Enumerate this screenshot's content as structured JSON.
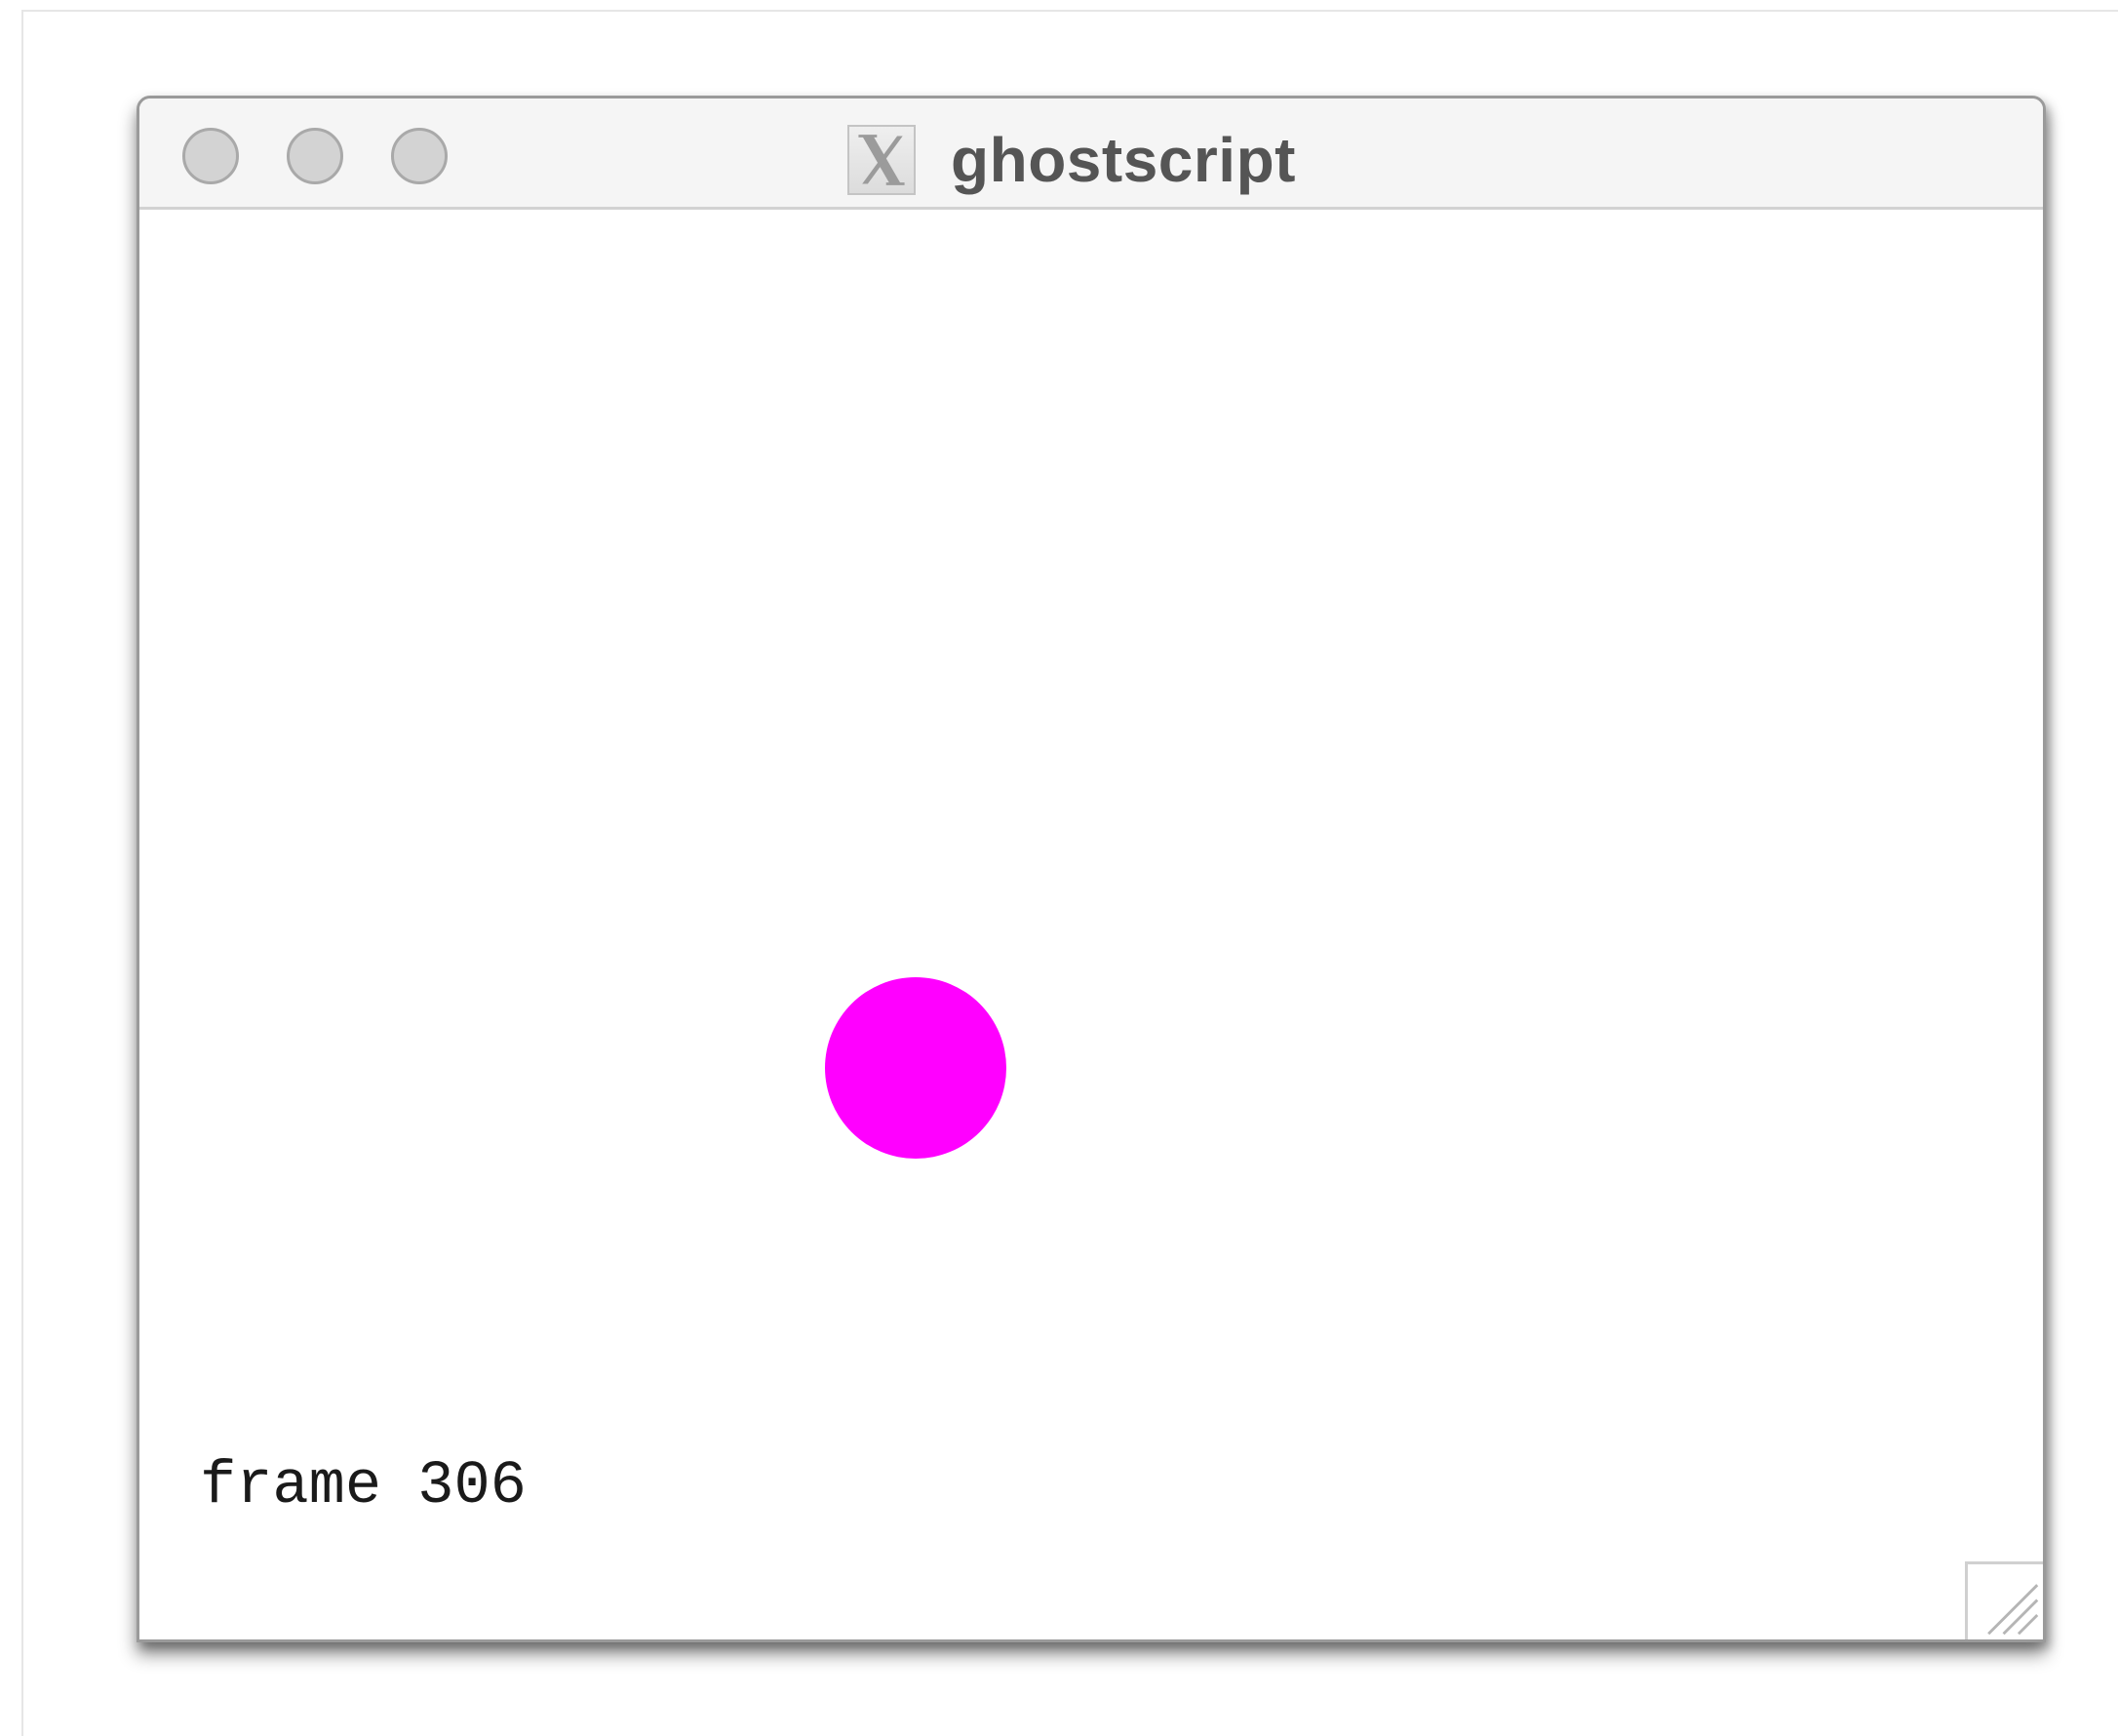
{
  "window": {
    "title": "ghostscript",
    "icon": "x11-icon"
  },
  "title_controls": {
    "close": "close-button",
    "minimize": "minimize-button",
    "zoom": "zoom-button"
  },
  "canvas": {
    "frame_label": "frame 306",
    "ball_color": "#ff00ff"
  },
  "colors": {
    "titlebar": "#f5f5f5",
    "traffic_light": "#d3d3d3",
    "title_text": "#555555"
  }
}
